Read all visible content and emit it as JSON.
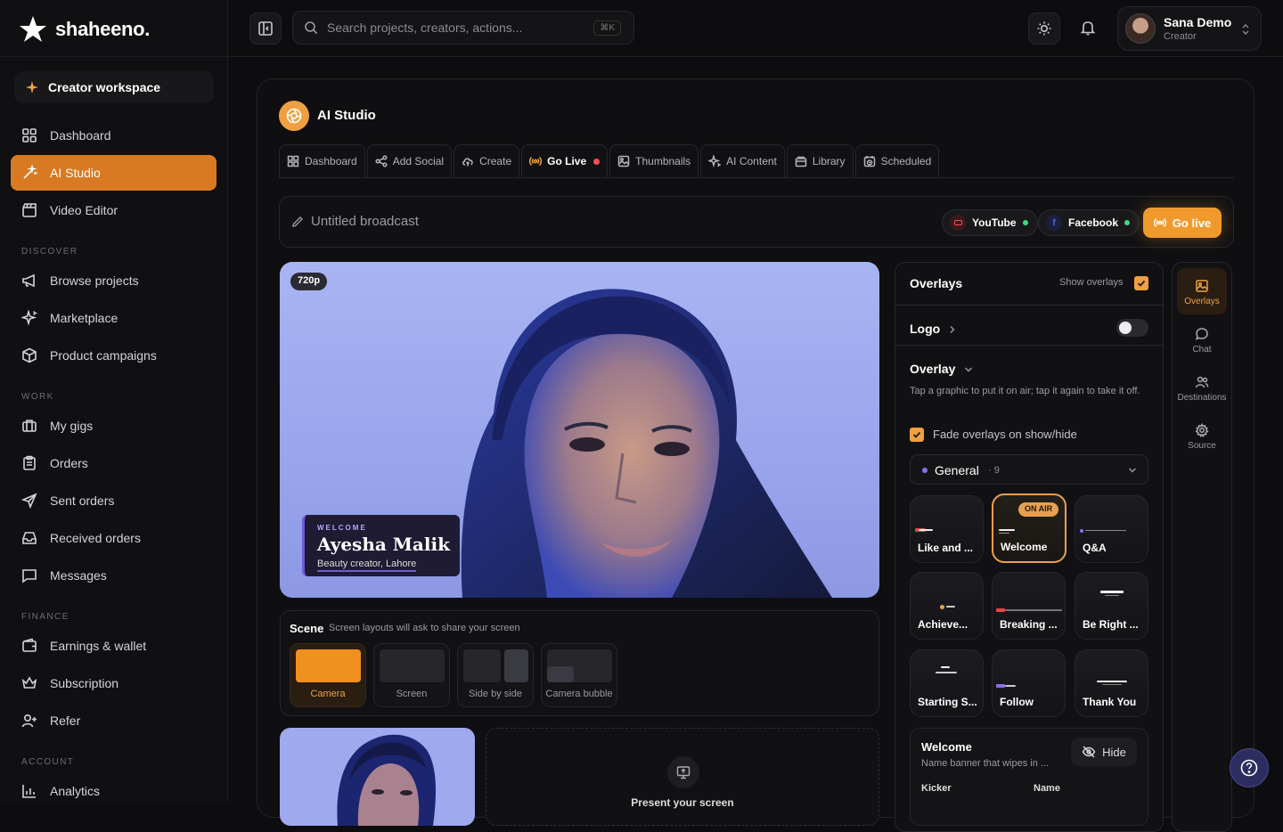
{
  "brand": {
    "name": "shaheeno."
  },
  "workspace": {
    "label": "Creator workspace"
  },
  "nav": {
    "dashboard": "Dashboard",
    "ai_studio": "AI Studio",
    "video_editor": "Video Editor",
    "section_discover": "DISCOVER",
    "browse": "Browse projects",
    "marketplace": "Marketplace",
    "campaigns": "Product campaigns",
    "section_work": "WORK",
    "gigs": "My gigs",
    "orders": "Orders",
    "sent": "Sent orders",
    "received": "Received orders",
    "messages": "Messages",
    "section_finance": "FINANCE",
    "earnings": "Earnings & wallet",
    "subscription": "Subscription",
    "refer": "Refer",
    "section_account": "ACCOUNT",
    "analytics": "Analytics"
  },
  "topbar": {
    "search_placeholder": "Search projects, creators, actions...",
    "shortcut": "⌘K",
    "user_name": "Sana Demo",
    "user_role": "Creator"
  },
  "studio": {
    "title": "AI Studio",
    "tabs": [
      "Dashboard",
      "Add Social",
      "Create",
      "Go Live",
      "Thumbnails",
      "AI Content",
      "Library",
      "Scheduled"
    ],
    "broadcast_placeholder": "Untitled broadcast",
    "dest_youtube": "YouTube",
    "dest_facebook": "Facebook",
    "go_live": "Go live"
  },
  "preview": {
    "resolution": "720p",
    "lower_third": {
      "kicker": "WELCOME",
      "name": "Ayesha Malik",
      "subtitle": "Beauty creator, Lahore"
    }
  },
  "scene": {
    "title": "Scene",
    "subtitle": "Screen layouts will ask to share your screen",
    "layouts": [
      "Camera",
      "Screen",
      "Side by side",
      "Camera bubble"
    ]
  },
  "present": {
    "label": "Present your screen"
  },
  "overlays": {
    "title": "Overlays",
    "show_label": "Show overlays",
    "logo": "Logo",
    "overlay": "Overlay",
    "overlay_desc": "Tap a graphic to put it on air; tap it again to take it off.",
    "fade_label": "Fade overlays on show/hide",
    "group": "General",
    "group_count": "· 9",
    "on_air": "ON AIR",
    "cards": [
      "Like and ...",
      "Welcome",
      "Q&A",
      "Achieve...",
      "Breaking ...",
      "Be Right ...",
      "Starting S...",
      "Follow",
      "Thank You"
    ],
    "selected_title": "Welcome",
    "selected_desc": "Name banner that wipes in ...",
    "hide": "Hide",
    "field_kicker": "Kicker",
    "field_name": "Name"
  },
  "rail": {
    "overlays": "Overlays",
    "chat": "Chat",
    "destinations": "Destinations",
    "source": "Source"
  },
  "colors": {
    "accent": "#d97a22",
    "accent_light": "#f0a040",
    "live": "#ff4d4f",
    "online": "#3ddc84"
  }
}
